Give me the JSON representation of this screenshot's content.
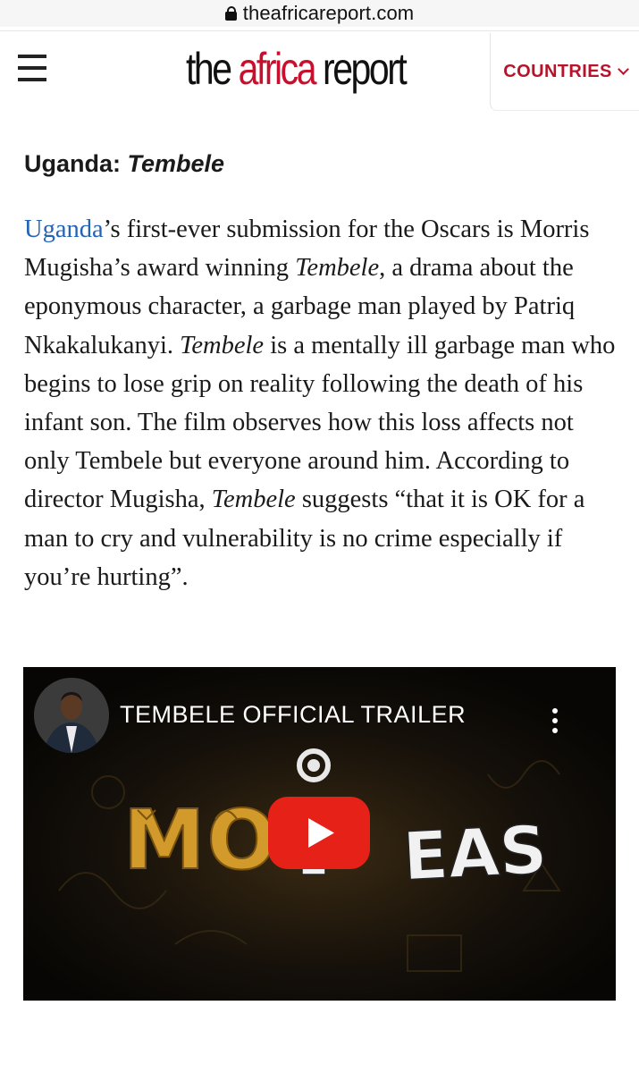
{
  "browser": {
    "url": "theafricareport.com"
  },
  "header": {
    "logo": {
      "part1": "the",
      "part2": "africa",
      "part3": "report"
    },
    "countries_label": "COUNTRIES"
  },
  "article": {
    "heading": {
      "prefix": "Uganda: ",
      "emph": "Tembele"
    },
    "para": {
      "link": "Uganda",
      "s1": "’s first-ever submission for the Oscars is Morris Mugisha’s award winning ",
      "e1": "Tembele",
      "s2": ", a drama about the eponymous character, a garbage man played by Patriq Nkakalukanyi. ",
      "e2": "Tembele",
      "s3": " is a mentally ill garbage man who begins to lose grip on reality following the death of his infant son. The film observes how this loss affects not only Tembele but everyone around him. According to director Mugisha, ",
      "e3": "Tembele",
      "s4": " suggests “that it is OK for a man to cry and vulnerability is no crime especially if you’re hurting”."
    }
  },
  "video": {
    "title": "TEMBELE OFFICIAL TRAILER",
    "wordmark": "MOIDEAS",
    "colors": {
      "wordmark_gold": "#d19a2a",
      "play_red": "#e62117"
    }
  }
}
